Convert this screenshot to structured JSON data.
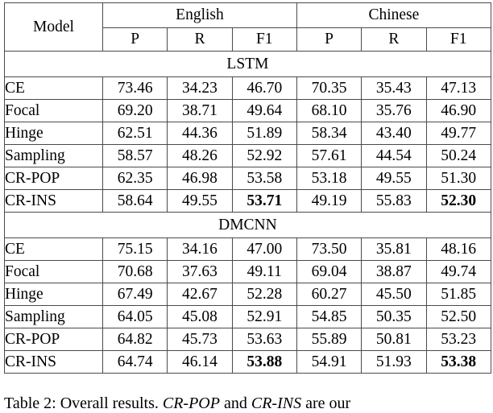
{
  "table": {
    "header": {
      "model_label": "Model",
      "lang_groups": [
        "English",
        "Chinese"
      ],
      "metrics": [
        "P",
        "R",
        "F1",
        "P",
        "R",
        "F1"
      ]
    },
    "sections": [
      {
        "band_label": "LSTM",
        "rows": [
          {
            "model": "CE",
            "values": [
              "73.46",
              "34.23",
              "46.70",
              "70.35",
              "35.43",
              "47.13"
            ],
            "bold": [
              false,
              false,
              false,
              false,
              false,
              false
            ],
            "group_start": true
          },
          {
            "model": "Focal",
            "values": [
              "69.20",
              "38.71",
              "49.64",
              "68.10",
              "35.76",
              "46.90"
            ],
            "bold": [
              false,
              false,
              false,
              false,
              false,
              false
            ],
            "group_start": false
          },
          {
            "model": "Hinge",
            "values": [
              "62.51",
              "44.36",
              "51.89",
              "58.34",
              "43.40",
              "49.77"
            ],
            "bold": [
              false,
              false,
              false,
              false,
              false,
              false
            ],
            "group_start": false
          },
          {
            "model": "Sampling",
            "values": [
              "58.57",
              "48.26",
              "52.92",
              "57.61",
              "44.54",
              "50.24"
            ],
            "bold": [
              false,
              false,
              false,
              false,
              false,
              false
            ],
            "group_start": false
          },
          {
            "model": "CR-POP",
            "values": [
              "62.35",
              "46.98",
              "53.58",
              "53.18",
              "49.55",
              "51.30"
            ],
            "bold": [
              false,
              false,
              false,
              false,
              false,
              false
            ],
            "group_start": true
          },
          {
            "model": "CR-INS",
            "values": [
              "58.64",
              "49.55",
              "53.71",
              "49.19",
              "55.83",
              "52.30"
            ],
            "bold": [
              false,
              false,
              true,
              false,
              false,
              true
            ],
            "group_start": false
          }
        ]
      },
      {
        "band_label": "DMCNN",
        "rows": [
          {
            "model": "CE",
            "values": [
              "75.15",
              "34.16",
              "47.00",
              "73.50",
              "35.81",
              "48.16"
            ],
            "bold": [
              false,
              false,
              false,
              false,
              false,
              false
            ],
            "group_start": true
          },
          {
            "model": "Focal",
            "values": [
              "70.68",
              "37.63",
              "49.11",
              "69.04",
              "38.87",
              "49.74"
            ],
            "bold": [
              false,
              false,
              false,
              false,
              false,
              false
            ],
            "group_start": false
          },
          {
            "model": "Hinge",
            "values": [
              "67.49",
              "42.67",
              "52.28",
              "60.27",
              "45.50",
              "51.85"
            ],
            "bold": [
              false,
              false,
              false,
              false,
              false,
              false
            ],
            "group_start": false
          },
          {
            "model": "Sampling",
            "values": [
              "64.05",
              "45.08",
              "52.91",
              "54.85",
              "50.35",
              "52.50"
            ],
            "bold": [
              false,
              false,
              false,
              false,
              false,
              false
            ],
            "group_start": false
          },
          {
            "model": "CR-POP",
            "values": [
              "64.82",
              "45.73",
              "53.63",
              "55.89",
              "50.81",
              "53.23"
            ],
            "bold": [
              false,
              false,
              false,
              false,
              false,
              false
            ],
            "group_start": true
          },
          {
            "model": "CR-INS",
            "values": [
              "64.74",
              "46.14",
              "53.88",
              "54.91",
              "51.93",
              "53.38"
            ],
            "bold": [
              false,
              false,
              true,
              false,
              false,
              true
            ],
            "group_start": false
          }
        ]
      }
    ]
  },
  "caption": {
    "prefix": "Table 2: Overall results. ",
    "italic_1": "CR-POP",
    "mid": " and ",
    "italic_2": "CR-INS",
    "suffix": " are our"
  }
}
